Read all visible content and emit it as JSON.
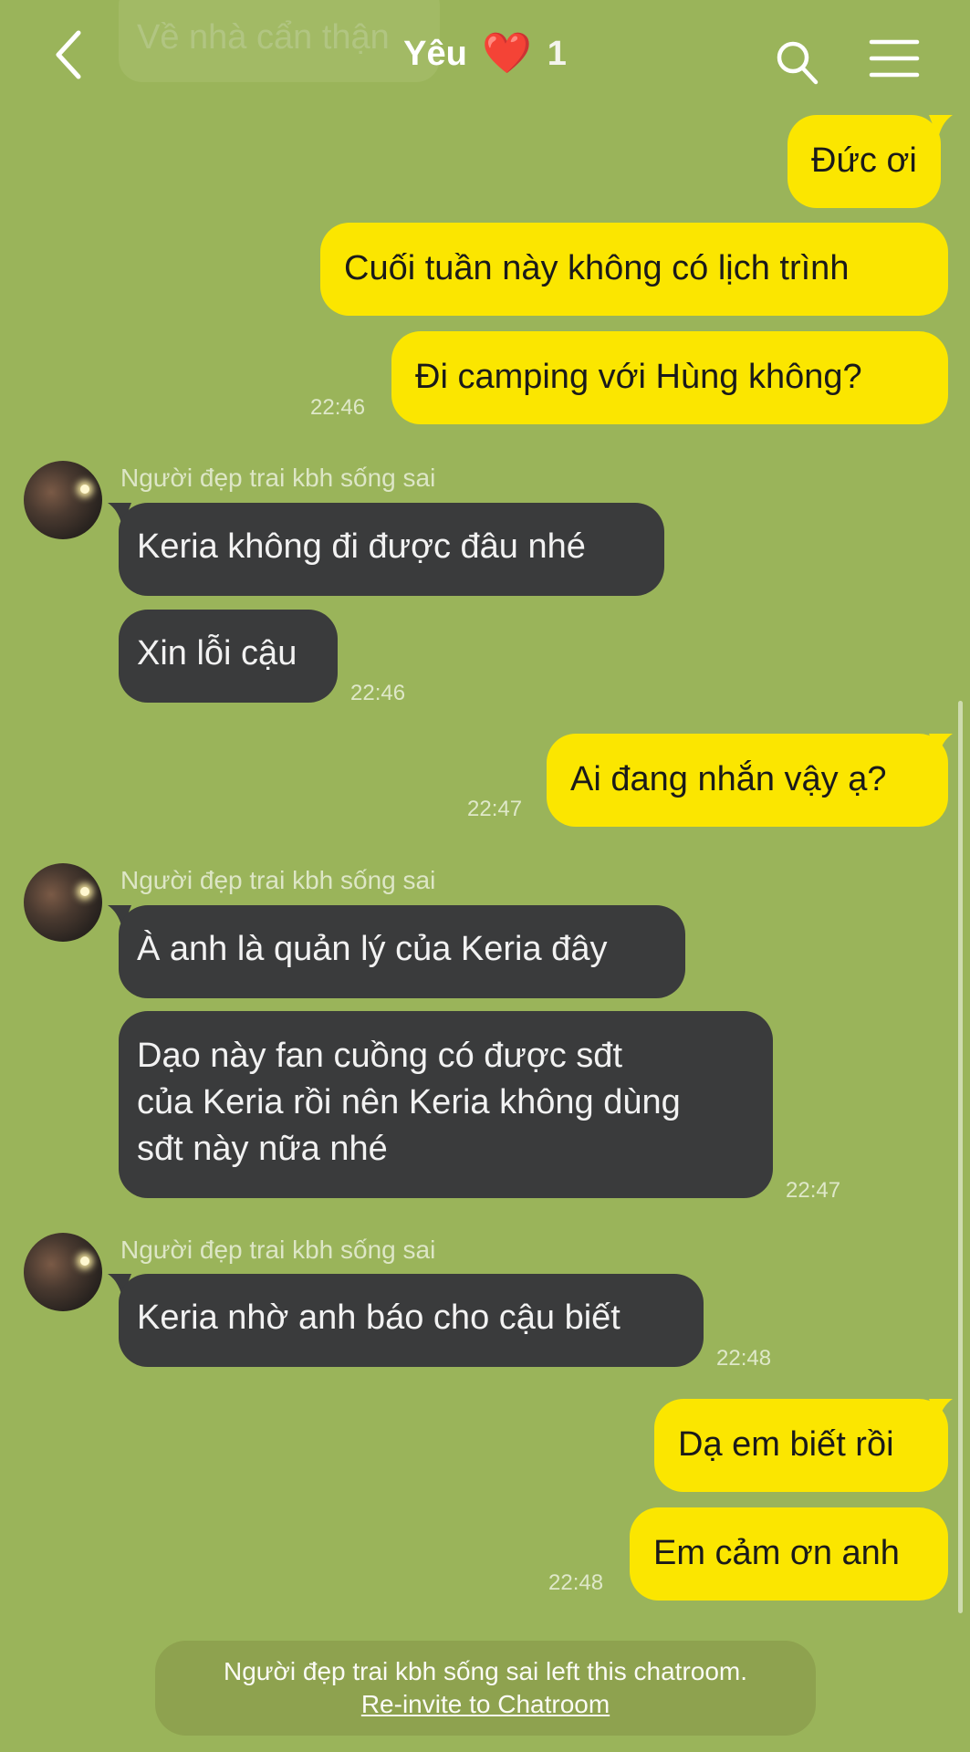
{
  "header": {
    "title": "Yêu",
    "heart": "❤️",
    "count": "1",
    "back_icon": "chevron-left-icon",
    "search_icon": "search-icon",
    "menu_icon": "hamburger-menu-icon"
  },
  "ghost_message": "Về nhà cẩn thận",
  "messages": {
    "m1": "Đức ơi",
    "m2": "Cuối tuần này không có lịch trình",
    "m3": "Đi camping với Hùng không?",
    "t1": "22:46",
    "sender1": "Người đẹp trai kbh sống sai",
    "r1": "Keria không đi được đâu nhé",
    "r2": "Xin lỗi cậu",
    "t2": "22:46",
    "m4": "Ai đang nhắn vậy ạ?",
    "t3": "22:47",
    "sender2": "Người đẹp trai kbh sống sai",
    "r3": "À anh là quản lý của Keria đây",
    "r4_line1": "Dạo này fan cuồng có được sđt",
    "r4_line2": "của Keria rồi nên Keria không dùng",
    "r4_line3": "sđt này nữa nhé",
    "t4": "22:47",
    "sender3": "Người đẹp trai kbh sống sai",
    "r5": "Keria nhờ anh báo cho cậu biết",
    "t5": "22:48",
    "m5": "Dạ em biết rồi",
    "m6": "Em cảm ơn anh",
    "t6": "22:48"
  },
  "notice": {
    "text": "Người đẹp trai kbh sống sai left this chatroom.",
    "link": "Re-invite to Chatroom"
  },
  "colors": {
    "background": "#9ab45a",
    "my_bubble": "#fbe600",
    "their_bubble": "#3a3b3c",
    "heart": "#e8211e"
  }
}
